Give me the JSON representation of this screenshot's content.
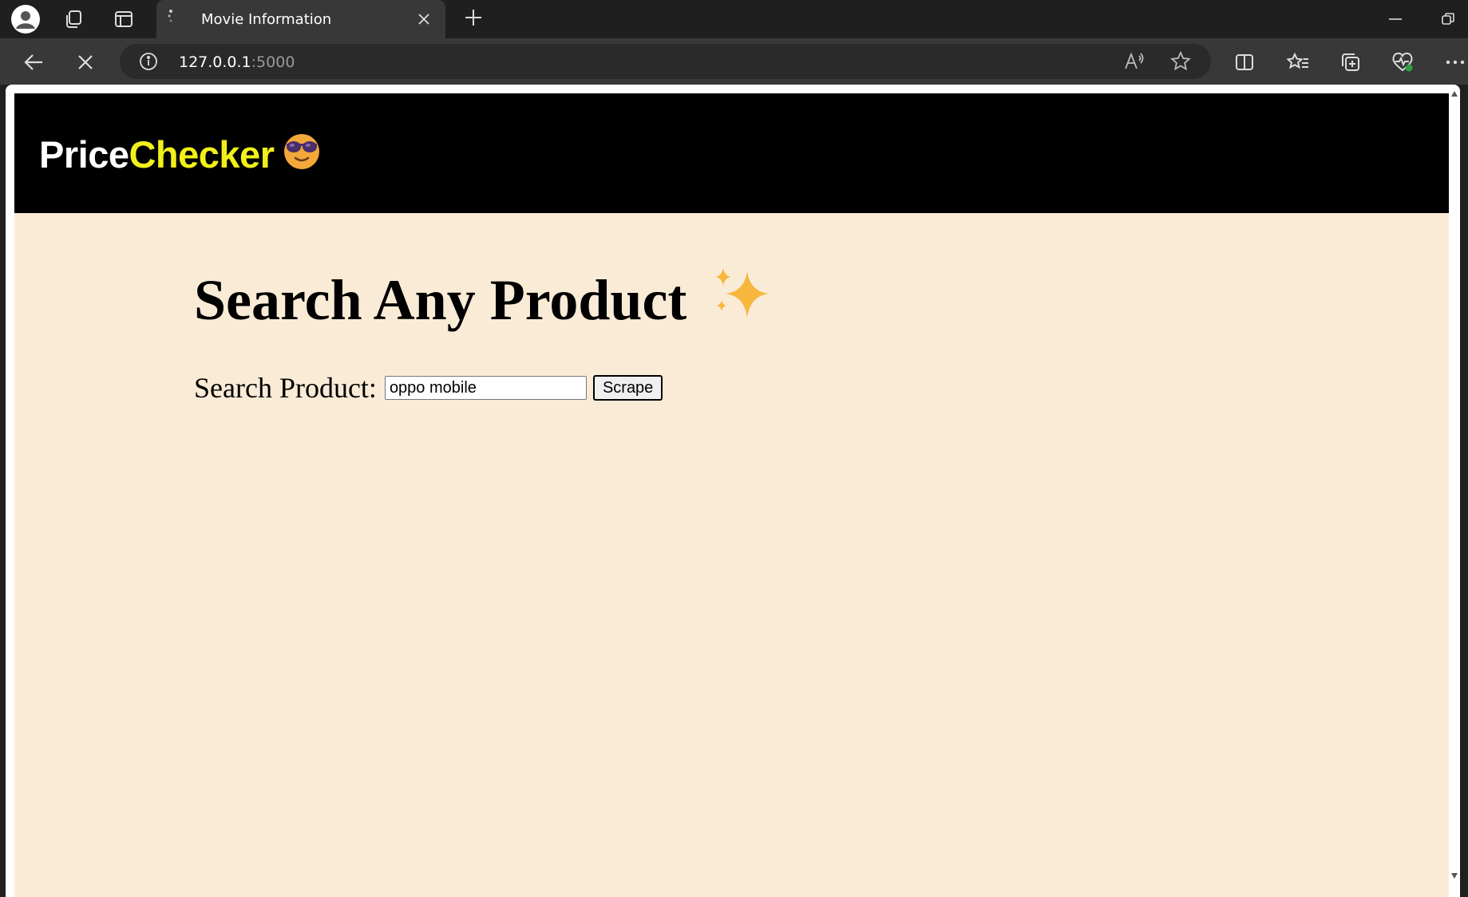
{
  "browser": {
    "tab_title": "Movie Information",
    "url_host": "127.0.0.1",
    "url_port": ":5000",
    "icons": [
      "profile-icon",
      "workspaces-icon",
      "tab-actions-icon",
      "loading-spinner-icon",
      "close-icon",
      "plus-icon",
      "minimize-icon",
      "restore-icon",
      "back-icon",
      "stop-icon",
      "info-icon",
      "read-aloud-icon",
      "favorite-star-icon",
      "split-screen-icon",
      "favorites-icon",
      "collections-icon",
      "browser-essentials-icon",
      "more-icon"
    ]
  },
  "site": {
    "logo_price": "Price",
    "logo_checker": "Checker",
    "logo_emoji": "😎"
  },
  "main": {
    "heading": "Search Any Product",
    "heading_emoji": "✨",
    "search_label": "Search Product:",
    "search_value": "oppo mobile",
    "button_label": "Scrape"
  },
  "colors": {
    "page_background": "#faebd7",
    "header_background": "#000000",
    "logo_price": "#ffffff",
    "logo_checker": "#f1f11a"
  }
}
